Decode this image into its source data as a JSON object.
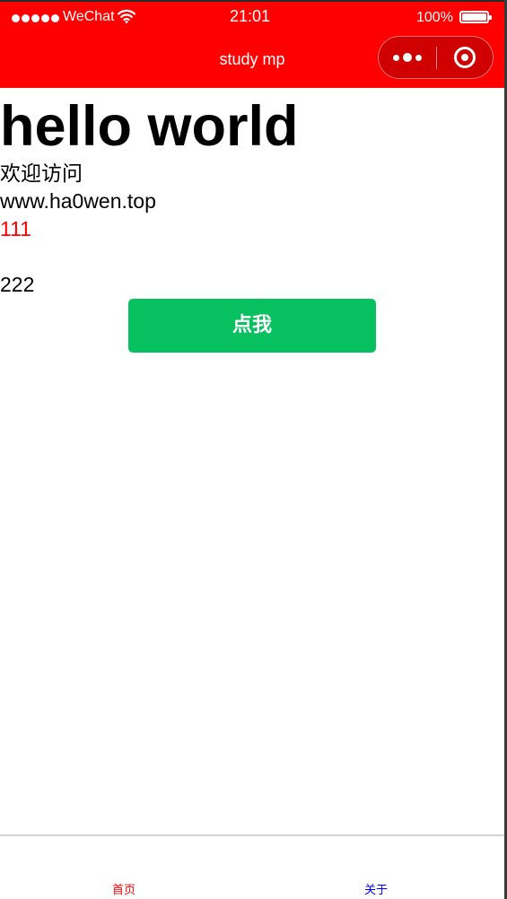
{
  "status_bar": {
    "carrier": "WeChat",
    "time": "21:01",
    "battery": "100%"
  },
  "nav": {
    "title": "study mp"
  },
  "colors": {
    "nav_background": "#ff0000",
    "button_background": "#07c160",
    "tab_selected": "#ff0000",
    "tab_unselected": "#0000ff"
  },
  "content": {
    "heading": "hello world",
    "welcome": "欢迎访问",
    "site": "www.ha0wen.top",
    "value_1": "111",
    "value_2": "222",
    "button_label": "点我"
  },
  "tabbar": {
    "items": [
      {
        "label": "首页",
        "selected": true
      },
      {
        "label": "关于",
        "selected": false
      }
    ]
  }
}
